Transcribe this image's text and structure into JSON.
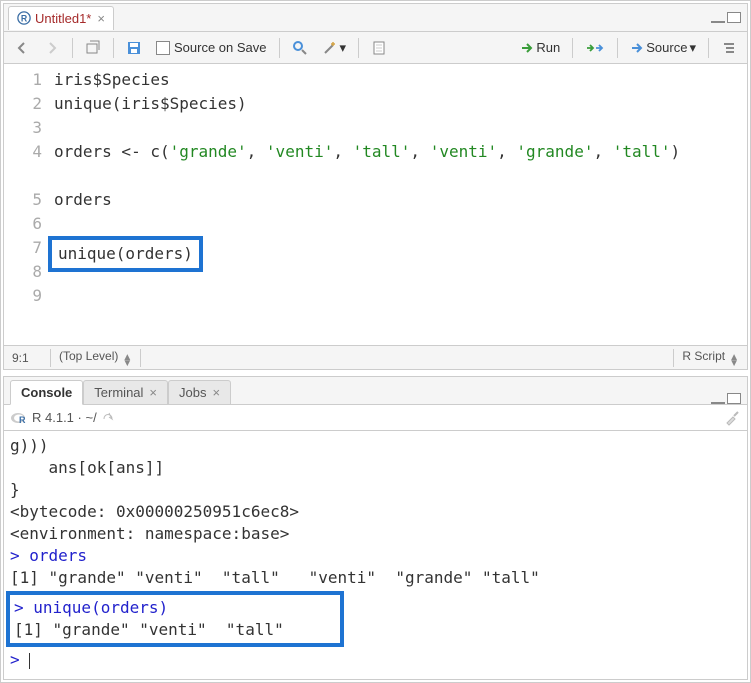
{
  "source": {
    "tab_title": "Untitled1*",
    "source_on_save_label": "Source on Save",
    "run_label": "Run",
    "source_label": "Source",
    "cursor_pos": "9:1",
    "scope": "(Top Level)",
    "lang": "R Script",
    "lines": [
      {
        "n": "1",
        "t": "iris$Species"
      },
      {
        "n": "2",
        "t": "unique(iris$Species)"
      },
      {
        "n": "3",
        "t": ""
      },
      {
        "n": "4",
        "t": "orders <- c('grande', 'venti', 'tall', 'venti', 'grande', 'tall')",
        "wrap": true
      },
      {
        "n": "5",
        "t": ""
      },
      {
        "n": "6",
        "t": "orders"
      },
      {
        "n": "7",
        "t": ""
      },
      {
        "n": "8",
        "t": "unique(orders)",
        "box": true
      },
      {
        "n": "9",
        "t": ""
      }
    ]
  },
  "console": {
    "tabs": {
      "console": "Console",
      "terminal": "Terminal",
      "jobs": "Jobs"
    },
    "version": "R 4.1.1",
    "path": "~/",
    "lines": [
      "g)))",
      "    ans[ok[ans]]",
      "}",
      "<bytecode: 0x00000250951c6ec8>",
      "<environment: namespace:base>",
      "> orders",
      "[1] \"grande\" \"venti\"  \"tall\"   \"venti\"  \"grande\" \"tall\"  "
    ],
    "highlight": [
      "> unique(orders)",
      "[1] \"grande\" \"venti\"  \"tall\"  "
    ],
    "prompt": "> "
  }
}
